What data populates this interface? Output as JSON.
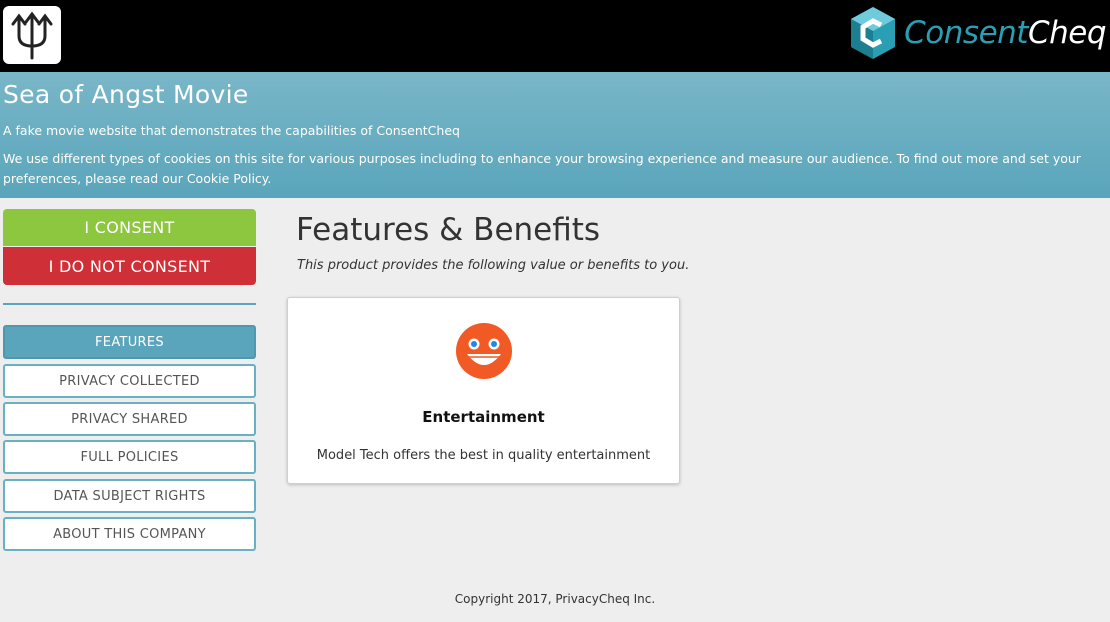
{
  "header": {
    "logo_icon": "trident-icon",
    "brand": {
      "part1": "Consent",
      "part2": "Cheq",
      "icon": "consentcheq-hex-icon",
      "accent": "#2a9fb3"
    }
  },
  "hero": {
    "title": "Sea of Angst Movie",
    "subtitle": "A fake movie website that demonstrates the capabilities of ConsentCheq",
    "notice_prefix": "We use different types of cookies on this site for various purposes including to enhance your browsing experience and measure our audience. To find out more and set your preferences, please read our ",
    "notice_link": "Cookie Policy",
    "notice_suffix": "."
  },
  "consent": {
    "consent_label": "I CONSENT",
    "no_consent_label": "I DO NOT CONSENT",
    "consent_color": "#8dc63f",
    "no_consent_color": "#cf2f36"
  },
  "nav": {
    "items": [
      {
        "label": "FEATURES",
        "active": true
      },
      {
        "label": "PRIVACY COLLECTED",
        "active": false
      },
      {
        "label": "PRIVACY SHARED",
        "active": false
      },
      {
        "label": "FULL POLICIES",
        "active": false
      },
      {
        "label": "DATA SUBJECT RIGHTS",
        "active": false
      },
      {
        "label": "ABOUT THIS COMPANY",
        "active": false
      }
    ]
  },
  "main": {
    "title": "Features & Benefits",
    "subtitle": "This product provides the following value or benefits to you.",
    "cards": [
      {
        "icon": "grinning-face-icon",
        "title": "Entertainment",
        "text": "Model Tech offers the best in quality entertainment"
      }
    ]
  },
  "footer": {
    "copyright": "Copyright 2017, PrivacyCheq Inc."
  }
}
